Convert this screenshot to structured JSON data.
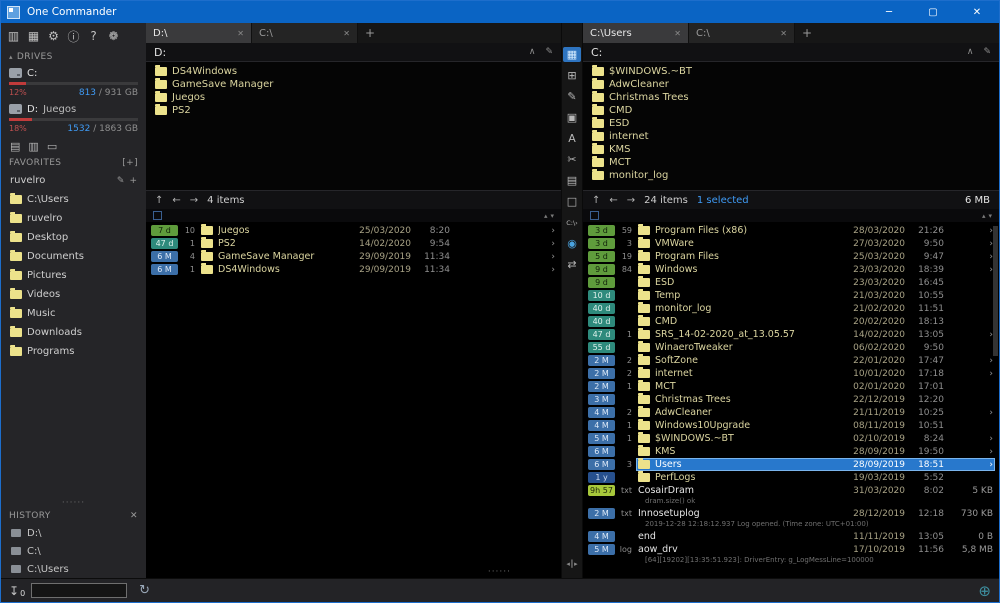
{
  "titlebar": {
    "title": "One Commander",
    "minimize": "─",
    "maximize": "▢",
    "close": "✕"
  },
  "toolbar": {
    "icons": [
      {
        "name": "layout-columns-icon",
        "glyph": "▥"
      },
      {
        "name": "layout-dual-pane-icon",
        "glyph": "▦"
      },
      {
        "name": "settings-gear-icon",
        "glyph": "⚙"
      },
      {
        "name": "info-icon",
        "glyph": "ⓘ"
      },
      {
        "name": "help-icon",
        "glyph": "?"
      },
      {
        "name": "theme-flower-icon",
        "glyph": "❁"
      }
    ]
  },
  "glyphs": {
    "tab_close": "✕",
    "collapse": "∧",
    "edit": "✎",
    "nav_up": "↑",
    "nav_back": "←",
    "nav_forward": "→",
    "sort_asc": "▴",
    "sort_desc": "▾",
    "chevron": "›",
    "add": "+",
    "dots": "······",
    "caret": "▴",
    "history_close": "✕",
    "favorites_add": "[+]"
  },
  "colors": {
    "titlebar": "#0a64c4",
    "selection": "#2878cc",
    "accent_blue": "#3f9bf5",
    "drive_bar": "#c13b3b",
    "folder_icon": "#ece28b"
  },
  "badge_colors": {
    "green": {
      "bg": "#5f9c3c",
      "fg": "#12230a"
    },
    "teal": {
      "bg": "#2e8a7c",
      "fg": "#dff2ec"
    },
    "blue": {
      "bg": "#3c6fa8",
      "fg": "#dde9f8"
    },
    "navy": {
      "bg": "#27508e",
      "fg": "#c9d9f2"
    },
    "lime": {
      "bg": "#a7c83b",
      "fg": "#20290a"
    }
  },
  "sidebar": {
    "drives_header": "DRIVES",
    "drives": [
      {
        "letter": "C:",
        "label": "",
        "used_pct": "12%",
        "used_frac": 0.13,
        "free": "813",
        "total": " / 931 GB"
      },
      {
        "letter": "D:",
        "label": "Juegos",
        "used_pct": "18%",
        "used_frac": 0.18,
        "free": "1532",
        "total": " / 1863 GB"
      }
    ],
    "device_icons": [
      {
        "name": "device-list-icon",
        "glyph": "▤"
      },
      {
        "name": "device-disk-icon",
        "glyph": "▥"
      },
      {
        "name": "device-eject-icon",
        "glyph": "▭"
      }
    ],
    "favorites_header": "FAVORITES",
    "profile": {
      "name": "ruvelro"
    },
    "favorites": [
      "C:\\Users",
      "ruvelro",
      "Desktop",
      "Documents",
      "Pictures",
      "Videos",
      "Music",
      "Downloads",
      "Programs"
    ],
    "history_header": "HISTORY",
    "history": [
      "D:\\",
      "C:\\",
      "C:\\Users"
    ]
  },
  "left_panel": {
    "tabs": [
      {
        "label": "D:\\",
        "active": true
      },
      {
        "label": "C:\\",
        "active": false
      }
    ],
    "new_tab": "+",
    "breadcrumb": "D:",
    "folders": [
      "DS4Windows",
      "GameSave Manager",
      "Juegos",
      "PS2"
    ],
    "nav": {
      "items": "4 items",
      "selected": "",
      "total_size": ""
    },
    "files": [
      {
        "age": "7 d",
        "badge": "green",
        "count": "10",
        "name": "Juegos",
        "date": "25/03/2020",
        "time": "8:20",
        "chevron": true
      },
      {
        "age": "47 d",
        "badge": "teal",
        "count": "1",
        "name": "PS2",
        "date": "14/02/2020",
        "time": "9:54",
        "chevron": true
      },
      {
        "age": "6 M",
        "badge": "blue",
        "count": "4",
        "name": "GameSave Manager",
        "date": "29/09/2019",
        "time": "11:34",
        "chevron": true
      },
      {
        "age": "6 M",
        "badge": "blue",
        "count": "1",
        "name": "DS4Windows",
        "date": "29/09/2019",
        "time": "11:34",
        "chevron": true
      }
    ]
  },
  "mid_toolbar": {
    "icons": [
      {
        "name": "preview-image-icon",
        "glyph": "▦",
        "variant": "active"
      },
      {
        "name": "new-folder-icon",
        "glyph": "⊞",
        "variant": ""
      },
      {
        "name": "edit-file-icon",
        "glyph": "✎",
        "variant": ""
      },
      {
        "name": "copy-icon",
        "glyph": "▣",
        "variant": ""
      },
      {
        "name": "rename-icon",
        "glyph": "A",
        "variant": ""
      },
      {
        "name": "cut-icon",
        "glyph": "✂",
        "variant": ""
      },
      {
        "name": "paste-icon",
        "glyph": "▤",
        "variant": ""
      },
      {
        "name": "new-file-icon",
        "glyph": "□",
        "variant": ""
      },
      {
        "name": "terminal-icon",
        "glyph": "C:\\›",
        "variant": "small"
      },
      {
        "name": "eye-icon",
        "glyph": "◉",
        "variant": "blue"
      },
      {
        "name": "swap-panels-icon",
        "glyph": "⇄",
        "variant": ""
      }
    ],
    "splitter": "◂┃▸"
  },
  "right_panel": {
    "tabs": [
      {
        "label": "C:\\Users",
        "active": true
      },
      {
        "label": "C:\\",
        "active": false
      }
    ],
    "new_tab": "+",
    "breadcrumb": "C:",
    "folders": [
      "$WINDOWS.~BT",
      "AdwCleaner",
      "Christmas Trees",
      "CMD",
      "ESD",
      "internet",
      "KMS",
      "MCT",
      "monitor_log"
    ],
    "nav": {
      "items": "24 items",
      "selected": "1 selected",
      "total_size": "6 MB"
    },
    "files": [
      {
        "age": "3 d",
        "badge": "green",
        "count": "59",
        "name": "Program Files (x86)",
        "date": "28/03/2020",
        "time": "21:26",
        "chevron": true
      },
      {
        "age": "3 d",
        "badge": "green",
        "count": "3",
        "name": "VMWare",
        "date": "27/03/2020",
        "time": "9:50",
        "chevron": true
      },
      {
        "age": "5 d",
        "badge": "green",
        "count": "19",
        "name": "Program Files",
        "date": "25/03/2020",
        "time": "9:47",
        "chevron": true
      },
      {
        "age": "9 d",
        "badge": "green",
        "count": "84",
        "name": "Windows",
        "date": "23/03/2020",
        "time": "18:39",
        "chevron": true
      },
      {
        "age": "9 d",
        "badge": "green",
        "count": "",
        "name": "ESD",
        "date": "23/03/2020",
        "time": "16:45",
        "chevron": false
      },
      {
        "age": "10 d",
        "badge": "teal",
        "count": "",
        "name": "Temp",
        "date": "21/03/2020",
        "time": "10:55",
        "chevron": false
      },
      {
        "age": "40 d",
        "badge": "teal",
        "count": "",
        "name": "monitor_log",
        "date": "21/02/2020",
        "time": "11:51",
        "chevron": false
      },
      {
        "age": "40 d",
        "badge": "teal",
        "count": "",
        "name": "CMD",
        "date": "20/02/2020",
        "time": "18:13",
        "chevron": false
      },
      {
        "age": "47 d",
        "badge": "teal",
        "count": "1",
        "name": "SRS_14-02-2020_at_13.05.57",
        "date": "14/02/2020",
        "time": "13:05",
        "chevron": true
      },
      {
        "age": "55 d",
        "badge": "teal",
        "count": "",
        "name": "WinaeroTweaker",
        "date": "06/02/2020",
        "time": "9:50",
        "chevron": false
      },
      {
        "age": "2 M",
        "badge": "blue",
        "count": "2",
        "name": "SoftZone",
        "date": "22/01/2020",
        "time": "17:47",
        "chevron": true
      },
      {
        "age": "2 M",
        "badge": "blue",
        "count": "2",
        "name": "internet",
        "date": "10/01/2020",
        "time": "17:18",
        "chevron": true
      },
      {
        "age": "2 M",
        "badge": "blue",
        "count": "1",
        "name": "MCT",
        "date": "02/01/2020",
        "time": "17:01",
        "chevron": false
      },
      {
        "age": "3 M",
        "badge": "blue",
        "count": "",
        "name": "Christmas Trees",
        "date": "22/12/2019",
        "time": "12:20",
        "chevron": false
      },
      {
        "age": "4 M",
        "badge": "blue",
        "count": "2",
        "name": "AdwCleaner",
        "date": "21/11/2019",
        "time": "10:25",
        "chevron": true
      },
      {
        "age": "4 M",
        "badge": "blue",
        "count": "1",
        "name": "Windows10Upgrade",
        "date": "08/11/2019",
        "time": "10:51",
        "chevron": false
      },
      {
        "age": "5 M",
        "badge": "blue",
        "count": "1",
        "name": "$WINDOWS.~BT",
        "date": "02/10/2019",
        "time": "8:24",
        "chevron": true
      },
      {
        "age": "6 M",
        "badge": "blue",
        "count": "",
        "name": "KMS",
        "date": "28/09/2019",
        "time": "19:50",
        "chevron": true
      },
      {
        "age": "6 M",
        "badge": "blue",
        "count": "3",
        "name": "Users",
        "date": "28/09/2019",
        "time": "18:51",
        "chevron": true,
        "selected": true
      },
      {
        "age": "1 y",
        "badge": "navy",
        "count": "",
        "name": "PerfLogs",
        "date": "19/03/2019",
        "time": "5:52",
        "chevron": false
      },
      {
        "age": "9h 57",
        "badge": "lime",
        "count": "txt",
        "name": "CosairDram",
        "date": "31/03/2020",
        "time": "8:02",
        "size": "5 KB",
        "file": true,
        "preview": "dram.size() ok"
      },
      {
        "age": "2 M",
        "badge": "blue",
        "count": "txt",
        "name": "Innosetuplog",
        "date": "28/12/2019",
        "time": "12:18",
        "size": "730 KB",
        "file": true,
        "preview": "2019-12-28 12:18:12.937   Log opened. (Time zone: UTC+01:00)"
      },
      {
        "age": "4 M",
        "badge": "blue",
        "count": "",
        "name": "end",
        "date": "11/11/2019",
        "time": "13:05",
        "size": "0 B",
        "file": true
      },
      {
        "age": "5 M",
        "badge": "blue",
        "count": "log",
        "name": "aow_drv",
        "date": "17/10/2019",
        "time": "11:56",
        "size": "5,8 MB",
        "file": true,
        "preview": "[64][19202][13:35:51.923]: DriverEntry: g_LogMessLine=100000"
      }
    ]
  },
  "statusbar": {
    "queue_count": "0",
    "filter_value": "",
    "download_glyph": "↧",
    "refresh_glyph": "↻",
    "globe_glyph": "⊕"
  }
}
